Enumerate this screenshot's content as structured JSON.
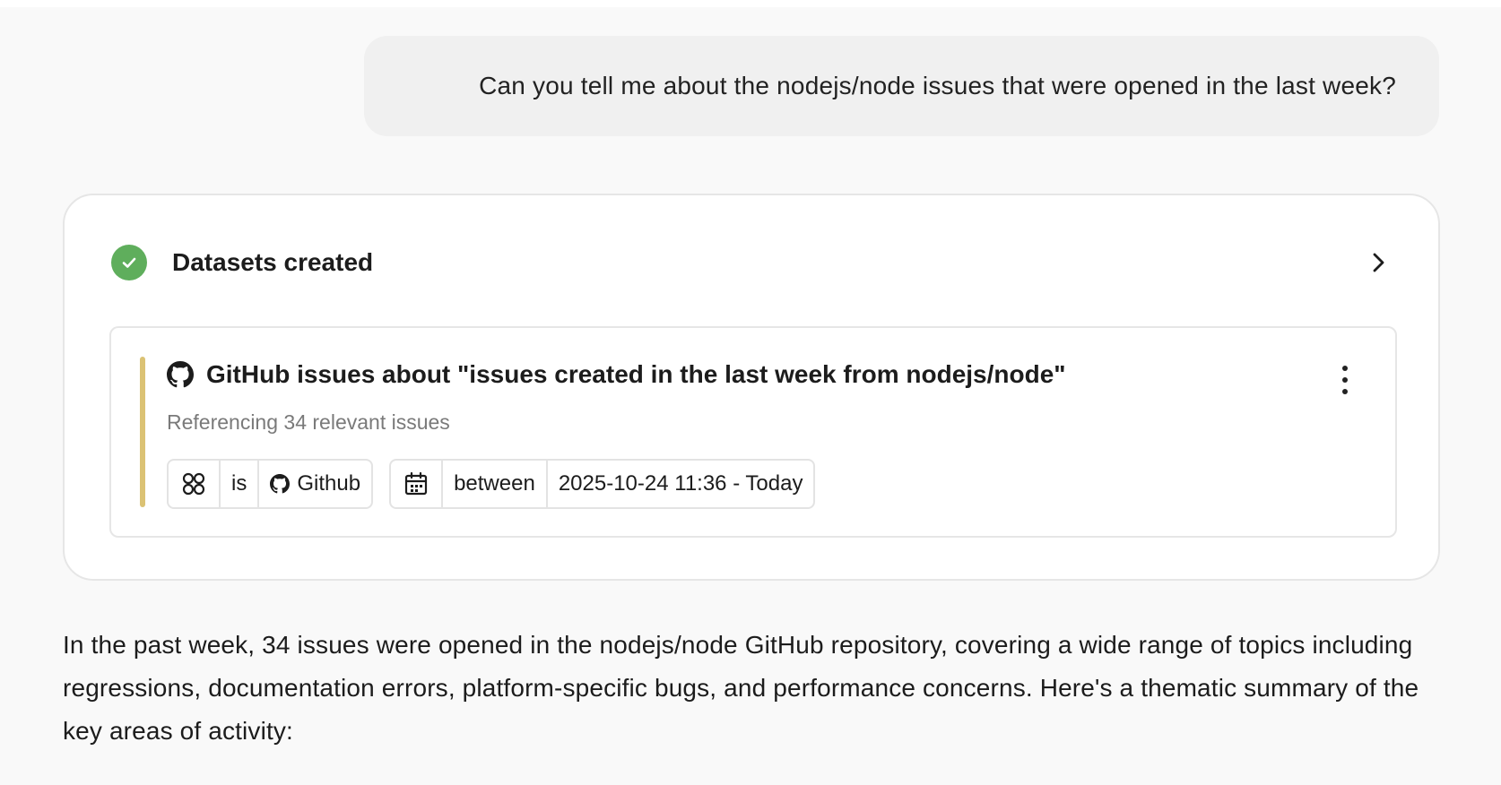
{
  "user_message": {
    "text": "Can you tell me about the nodejs/node issues that were opened in the last week?"
  },
  "datasets_card": {
    "title": "Datasets created",
    "status_icon": "check-circle-icon",
    "status_color": "#5fae5c",
    "dataset": {
      "icon": "github-icon",
      "title": "GitHub issues about \"issues created in the last week from nodejs/node\"",
      "subtitle": "Referencing 34 relevant issues",
      "accent_color": "#dbc274",
      "filters": [
        {
          "icon": "source-grid-icon",
          "operator": "is",
          "value_icon": "github-icon",
          "value": "Github"
        },
        {
          "icon": "calendar-icon",
          "operator": "between",
          "value": "2025-10-24 11:36 - Today"
        }
      ]
    }
  },
  "answer": {
    "text": "In the past week, 34 issues were opened in the nodejs/node GitHub repository, covering a wide range of topics including regressions, documentation errors, platform-specific bugs, and performance concerns. Here's a thematic summary of the key areas of activity:"
  }
}
